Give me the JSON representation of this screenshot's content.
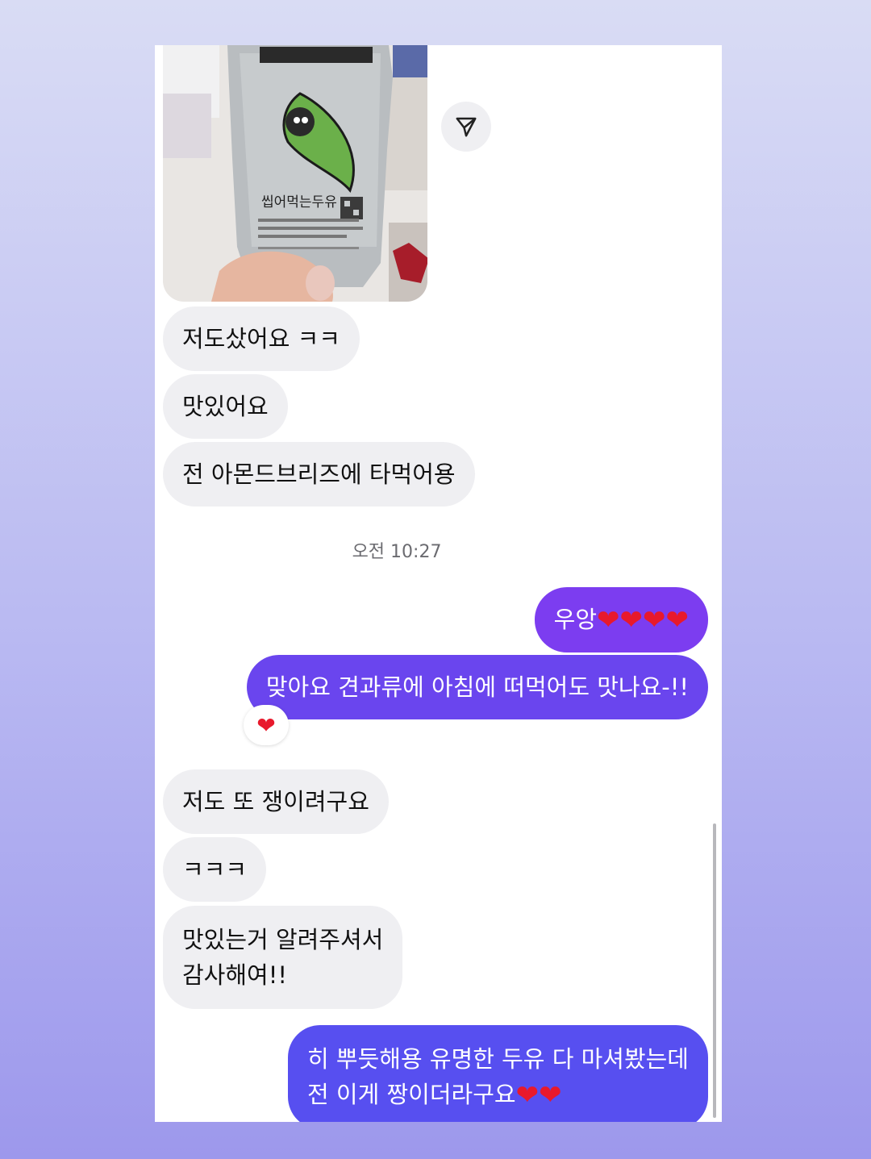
{
  "messages": {
    "m1": "저도샀어요 ㅋㅋ",
    "m2": "맛있어요",
    "m3": "전 아몬드브리즈에 타먹어용",
    "timestamp": "오전 10:27",
    "m4_text": "우앙",
    "m4_hearts": "❤❤❤❤",
    "m5": "맞아요 견과류에 아침에 떠먹어도 맛나요-!!",
    "m5_reaction": "❤",
    "m6": "저도 또 쟁이려구요",
    "m7": "ㅋㅋㅋ",
    "m8_line1": "맛있는거 알려주셔서",
    "m8_line2": "감사해여!!",
    "m9_line1": "히 뿌듯해용 유명한 두유 다 마셔봤는데",
    "m9_line2_text": "전 이게 짱이더라구요",
    "m9_line2_hearts": "❤❤"
  },
  "photo": {
    "package_text": "씹어먹는두유"
  },
  "colors": {
    "outgoing_1": "#7c3df0",
    "outgoing_2": "#6a45ee",
    "outgoing_3": "#574ff0",
    "incoming": "#efeff2",
    "heart": "#e8192c"
  },
  "icons": {
    "share": "send-icon",
    "reaction": "heart-reaction"
  }
}
